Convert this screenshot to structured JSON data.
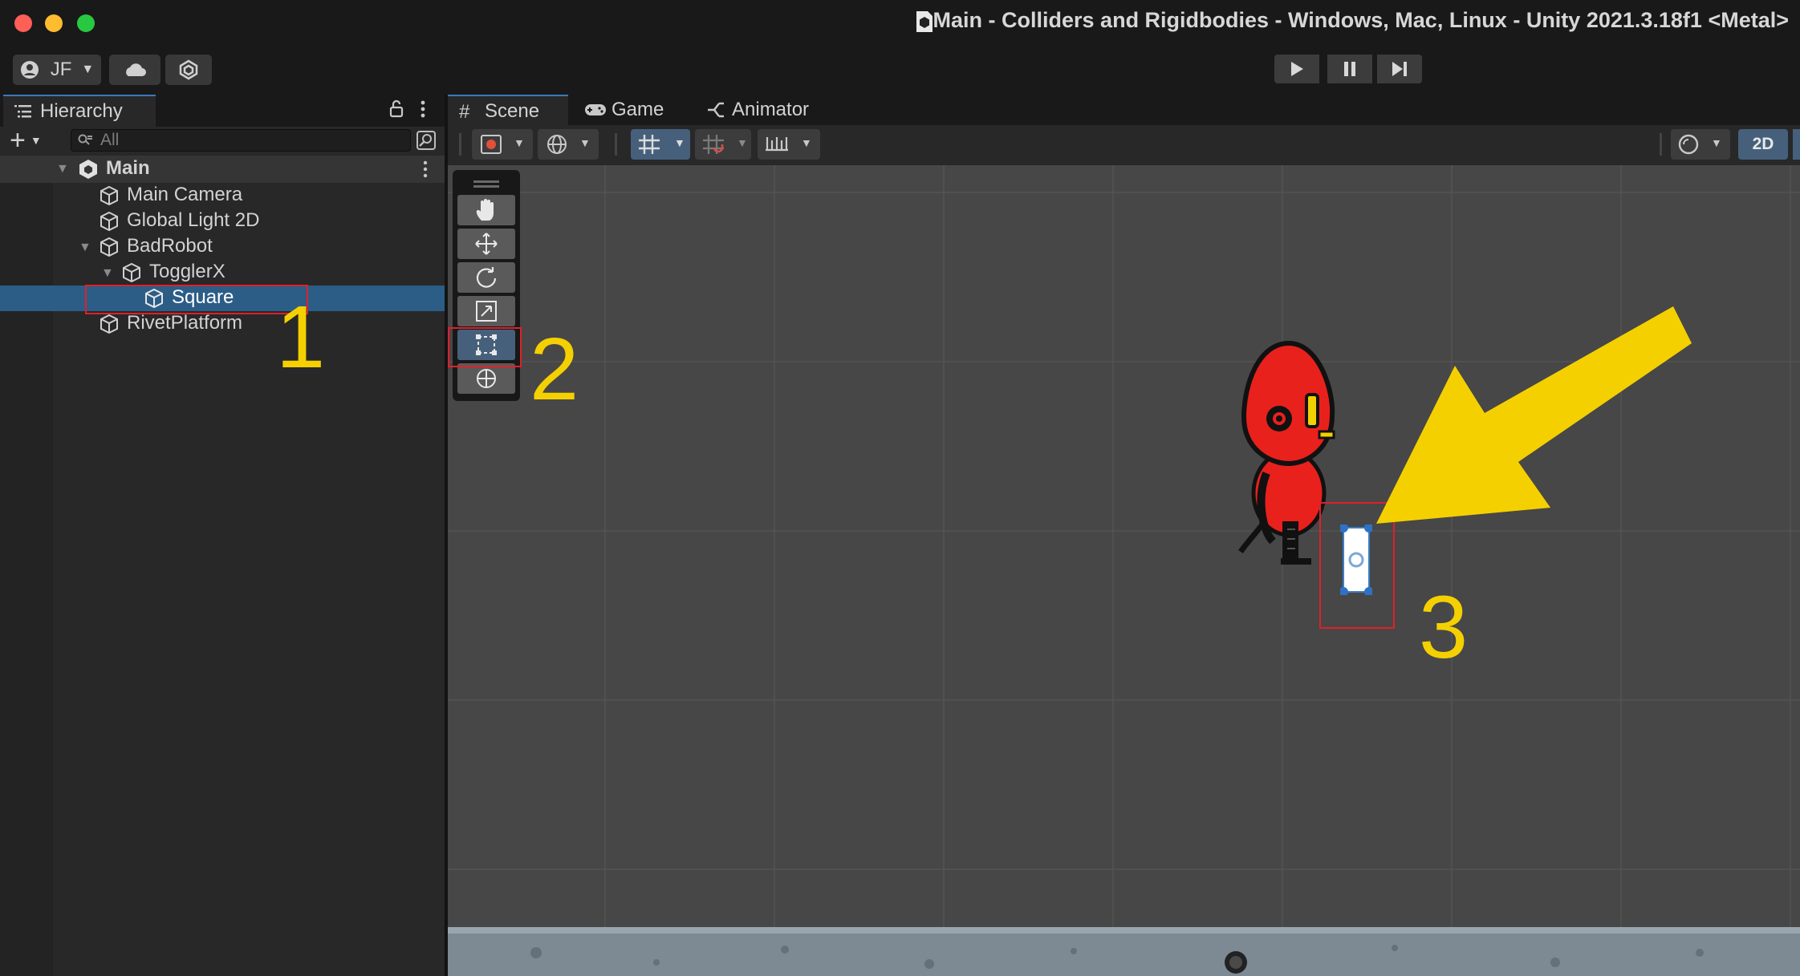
{
  "window": {
    "title": "Main - Colliders and Rigidbodies - Windows, Mac, Linux - Unity 2021.3.18f1 <Metal>"
  },
  "toolbar": {
    "account_label": "JF",
    "play_icon": "play-icon",
    "pause_icon": "pause-icon",
    "step_icon": "step-icon"
  },
  "hierarchy": {
    "tab_label": "Hierarchy",
    "search_placeholder": "All",
    "scene_name": "Main",
    "items": [
      {
        "label": "Main Camera"
      },
      {
        "label": "Global Light 2D"
      },
      {
        "label": "BadRobot"
      },
      {
        "label": "TogglerX"
      },
      {
        "label": "Square"
      },
      {
        "label": "RivetPlatform"
      }
    ],
    "selected_item": "Square"
  },
  "scene_tabs": [
    {
      "label": "Scene"
    },
    {
      "label": "Game"
    },
    {
      "label": "Animator"
    }
  ],
  "scene_toolbar": {
    "mode_2d_label": "2D"
  },
  "tools": [
    "hand-tool",
    "move-tool",
    "rotate-tool",
    "scale-tool",
    "rect-tool",
    "transform-tool"
  ],
  "active_tool": "rect-tool",
  "annotations": {
    "one": "1",
    "two": "2",
    "three": "3"
  },
  "colors": {
    "selection": "#2c5d87",
    "accent_tab": "#3a79bb",
    "annotation_yellow": "#f5d000",
    "highlight_red": "#e0202a",
    "robot_red": "#e8211c"
  }
}
